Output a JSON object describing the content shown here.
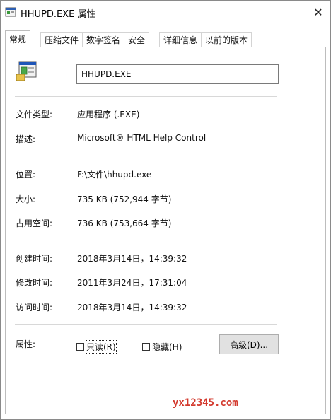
{
  "window": {
    "title": "HHUPD.EXE 属性",
    "close_glyph": "✕"
  },
  "tabs": [
    {
      "label": "常规"
    },
    {
      "label": "压缩文件"
    },
    {
      "label": "数字签名"
    },
    {
      "label": "安全"
    },
    {
      "label": "详细信息"
    },
    {
      "label": "以前的版本"
    }
  ],
  "general": {
    "file_name": "HHUPD.EXE",
    "file_type": {
      "label": "文件类型:",
      "value": "应用程序 (.EXE)"
    },
    "description": {
      "label": "描述:",
      "value": "Microsoft® HTML Help Control"
    },
    "location": {
      "label": "位置:",
      "value": "F:\\文件\\hhupd.exe"
    },
    "size": {
      "label": "大小:",
      "value": "735 KB (752,944 字节)"
    },
    "size_on_disk": {
      "label": "占用空间:",
      "value": "736 KB (753,664 字节)"
    },
    "created": {
      "label": "创建时间:",
      "value": "2018年3月14日，14:39:32"
    },
    "modified": {
      "label": "修改时间:",
      "value": "2011年3月24日，17:31:04"
    },
    "accessed": {
      "label": "访问时间:",
      "value": "2018年3月14日，14:39:32"
    },
    "attributes": {
      "label": "属性:",
      "readonly_label": "只读(R)",
      "readonly_checked": false,
      "hidden_label": "隐藏(H)",
      "hidden_checked": false,
      "advanced_button": "高级(D)..."
    }
  },
  "watermark": "yx12345.com",
  "icons": {
    "title_icon": "application-window-icon",
    "file_icon": "installer-package-icon"
  }
}
